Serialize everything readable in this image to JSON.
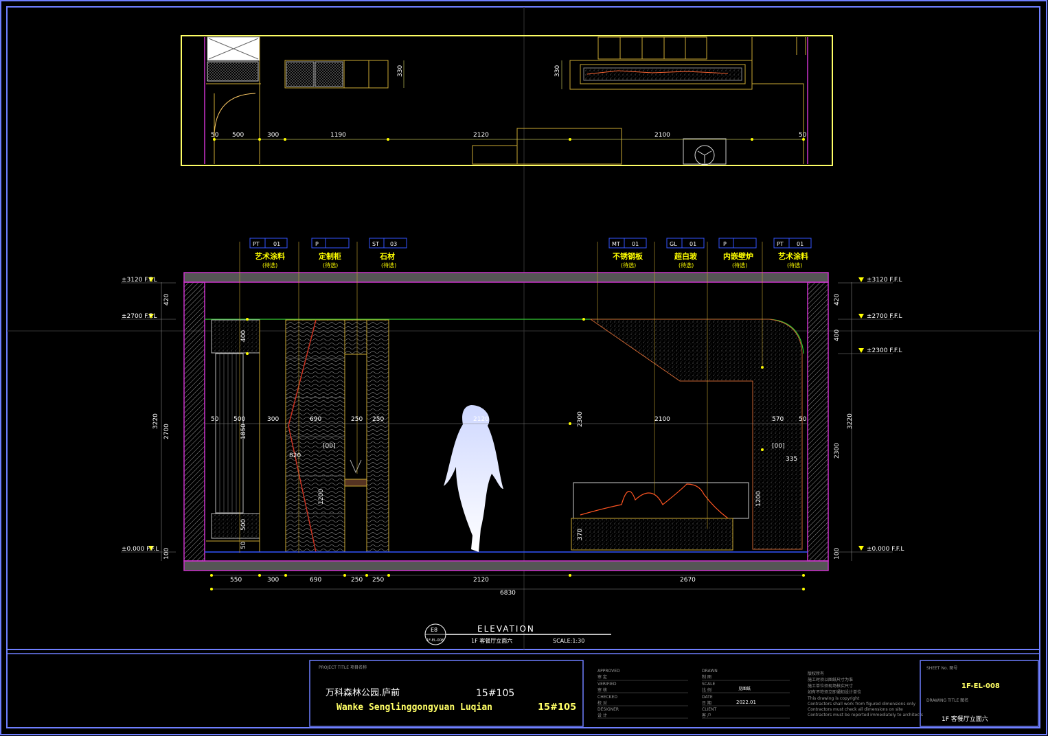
{
  "plan": {
    "dims_top": [
      "330",
      "330"
    ],
    "dims_row": [
      "50",
      "500",
      "300",
      "1190",
      "2120",
      "2100",
      "50"
    ]
  },
  "elevation": {
    "tags": [
      {
        "code": "PT",
        "num": "01",
        "label": "艺术涂料",
        "sub": "(待选)"
      },
      {
        "code": "P",
        "num": "",
        "label": "定制柜",
        "sub": "(待选)"
      },
      {
        "code": "ST",
        "num": "03",
        "label": "石材",
        "sub": "(待选)"
      },
      {
        "code": "MT",
        "num": "01",
        "label": "不锈钢板",
        "sub": "(待选)"
      },
      {
        "code": "GL",
        "num": "01",
        "label": "超白玻",
        "sub": "(待选)"
      },
      {
        "code": "P",
        "num": "",
        "label": "内嵌壁炉",
        "sub": "(待选)"
      },
      {
        "code": "PT",
        "num": "01",
        "label": "艺术涂料",
        "sub": "(待选)"
      }
    ],
    "levels_left": [
      "±3120 F.F.L",
      "±2700 F.F.L",
      "±0.000 F.F.L"
    ],
    "levels_right": [
      "±3120 F.F.L",
      "±2700 F.F.L",
      "±2300 F.F.L",
      "±0.000 F.F.L"
    ],
    "left_dims": [
      "420",
      "3220",
      "2700",
      "100"
    ],
    "right_dims": [
      "420",
      "400",
      "3220",
      "2300",
      "100"
    ],
    "inner_dims": [
      "400",
      "1850",
      "500",
      "50",
      "1200",
      "820",
      "2300",
      "1200",
      "370",
      "335"
    ],
    "mid_row": [
      "50",
      "500",
      "300",
      "690",
      "250",
      "250",
      "2120",
      "2100",
      "570",
      "50"
    ],
    "bottom_row": [
      "550",
      "300",
      "690",
      "250",
      "250",
      "2120",
      "2670"
    ],
    "total": "6830",
    "marks": [
      "[00]",
      "[00]"
    ]
  },
  "title_block": {
    "bubble_top": "E8",
    "bubble_bottom": "1F-EL-008",
    "heading": "ELEVATION",
    "sub_left": "1F 客餐厅立面六",
    "scale": "SCALE:1:30",
    "project_title_label": "PROJECT TITLE  项目名称",
    "project_cn": "万科森林公园.庐前",
    "project_no_cn": "15#105",
    "project_en": "Wanke Senglinggongyuan Luqian",
    "project_no_en": "15#105",
    "approved": "APPROVED",
    "approved_cn": "审 定",
    "verified": "VERIFIED",
    "verified_cn": "审 核",
    "checked": "CHECKED",
    "checked_cn": "校 对",
    "designer": "DESIGNER",
    "designer_cn": "设 计",
    "drawn": "DRAWN",
    "drawn_cn": "制 图",
    "scale_label": "SCALE",
    "scale_cn": "比 例",
    "scale_val": "见图纸",
    "date_label": "DATE",
    "date_cn": "日 期",
    "date_val": "2022.01",
    "client": "CLIENT",
    "client_cn": "客 户",
    "notes": [
      "版权所有",
      "施工时须以图纸尺寸为准",
      "施工单位须现场核实尺寸",
      "如有不符须立即通知设计单位",
      "This drawing is copyright",
      "Contractors shall work from figured dimensions only",
      "Contractors must check all dimensions on site",
      "Contractors must be reported immediately to architects"
    ],
    "sheet_no_label": "SHEET No.  图号",
    "sheet_no": "1F-EL-008",
    "drawing_title_label": "DRAWING TITLE  图名",
    "drawing_title": "1F  客餐厅立面六"
  }
}
